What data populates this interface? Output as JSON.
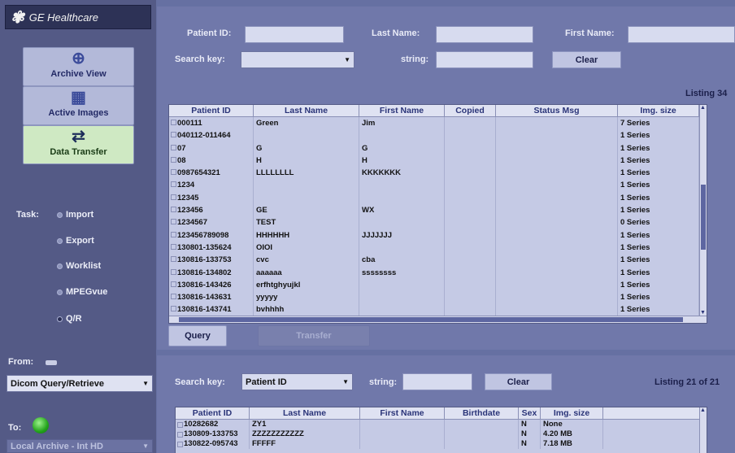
{
  "sidebar": {
    "brand": "GE Healthcare",
    "nav": [
      {
        "label": "Archive View",
        "icon": "globe-icon"
      },
      {
        "label": "Active Images",
        "icon": "images-icon"
      },
      {
        "label": "Data Transfer",
        "icon": "data-transfer-icon"
      }
    ],
    "task_label": "Task:",
    "tasks": [
      {
        "label": "Import",
        "selected": false
      },
      {
        "label": "Export",
        "selected": false
      },
      {
        "label": "Worklist",
        "selected": false
      },
      {
        "label": "MPEGvue",
        "selected": false
      },
      {
        "label": "Q/R",
        "selected": true
      }
    ],
    "from_label": "From:",
    "from_value": "Dicom Query/Retrieve",
    "to_label": "To:",
    "to_value": "Local Archive - Int HD"
  },
  "search": {
    "patient_id_label": "Patient ID:",
    "patient_id_value": "",
    "last_name_label": "Last Name:",
    "last_name_value": "",
    "first_name_label": "First Name:",
    "first_name_value": "",
    "search_key_label": "Search key:",
    "search_key_value": "",
    "string_label": "string:",
    "string_value": "",
    "clear_label": "Clear",
    "listing": "Listing 34"
  },
  "top_table": {
    "columns": [
      "Patient ID",
      "Last Name",
      "First Name",
      "Copied",
      "Status Msg",
      "Img. size"
    ],
    "rows": [
      [
        "000111",
        "Green",
        "Jim",
        "",
        "",
        "7 Series"
      ],
      [
        "040112-011464",
        "",
        "",
        "",
        "",
        "1 Series"
      ],
      [
        "07",
        "G",
        "G",
        "",
        "",
        "1 Series"
      ],
      [
        "08",
        "H",
        "H",
        "",
        "",
        "1 Series"
      ],
      [
        "0987654321",
        "LLLLLLLL",
        "KKKKKKK",
        "",
        "",
        "1 Series"
      ],
      [
        "1234",
        "",
        "",
        "",
        "",
        "1 Series"
      ],
      [
        "12345",
        "",
        "",
        "",
        "",
        "1 Series"
      ],
      [
        "123456",
        "GE",
        "WX",
        "",
        "",
        "1 Series"
      ],
      [
        "1234567",
        "TEST",
        "",
        "",
        "",
        "0 Series"
      ],
      [
        "123456789098",
        "HHHHHH",
        "JJJJJJJ",
        "",
        "",
        "1 Series"
      ],
      [
        "130801-135624",
        "OIOI",
        "",
        "",
        "",
        "1 Series"
      ],
      [
        "130816-133753",
        "cvc",
        "cba",
        "",
        "",
        "1 Series"
      ],
      [
        "130816-134802",
        "aaaaaa",
        "ssssssss",
        "",
        "",
        "1 Series"
      ],
      [
        "130816-143426",
        "erfhtghyujkl",
        "",
        "",
        "",
        "1 Series"
      ],
      [
        "130816-143631",
        "yyyyy",
        "",
        "",
        "",
        "1 Series"
      ],
      [
        "130816-143741",
        "bvhhhh",
        "",
        "",
        "",
        "1 Series"
      ]
    ]
  },
  "actions": {
    "query_label": "Query",
    "transfer_label": "Transfer"
  },
  "bottom": {
    "search_key_label": "Search key:",
    "search_key_value": "Patient ID",
    "string_label": "string:",
    "string_value": "",
    "clear_label": "Clear",
    "listing": "Listing 21 of 21",
    "columns": [
      "Patient ID",
      "Last Name",
      "First Name",
      "Birthdate",
      "Sex",
      "Img. size"
    ],
    "rows": [
      [
        "10282682",
        "ZY1",
        "",
        "",
        "N",
        "None"
      ],
      [
        "130809-133753",
        "ZZZZZZZZZZZ",
        "",
        "",
        "N",
        "4.20 MB"
      ],
      [
        "130822-095743",
        "FFFFF",
        "",
        "",
        "N",
        "7.18 MB"
      ]
    ]
  },
  "colors": {
    "panel": "#7078aa",
    "sidebar": "#545a86",
    "active_nav": "#cfe9c3",
    "scroll_thumb": "#5d66a1"
  }
}
